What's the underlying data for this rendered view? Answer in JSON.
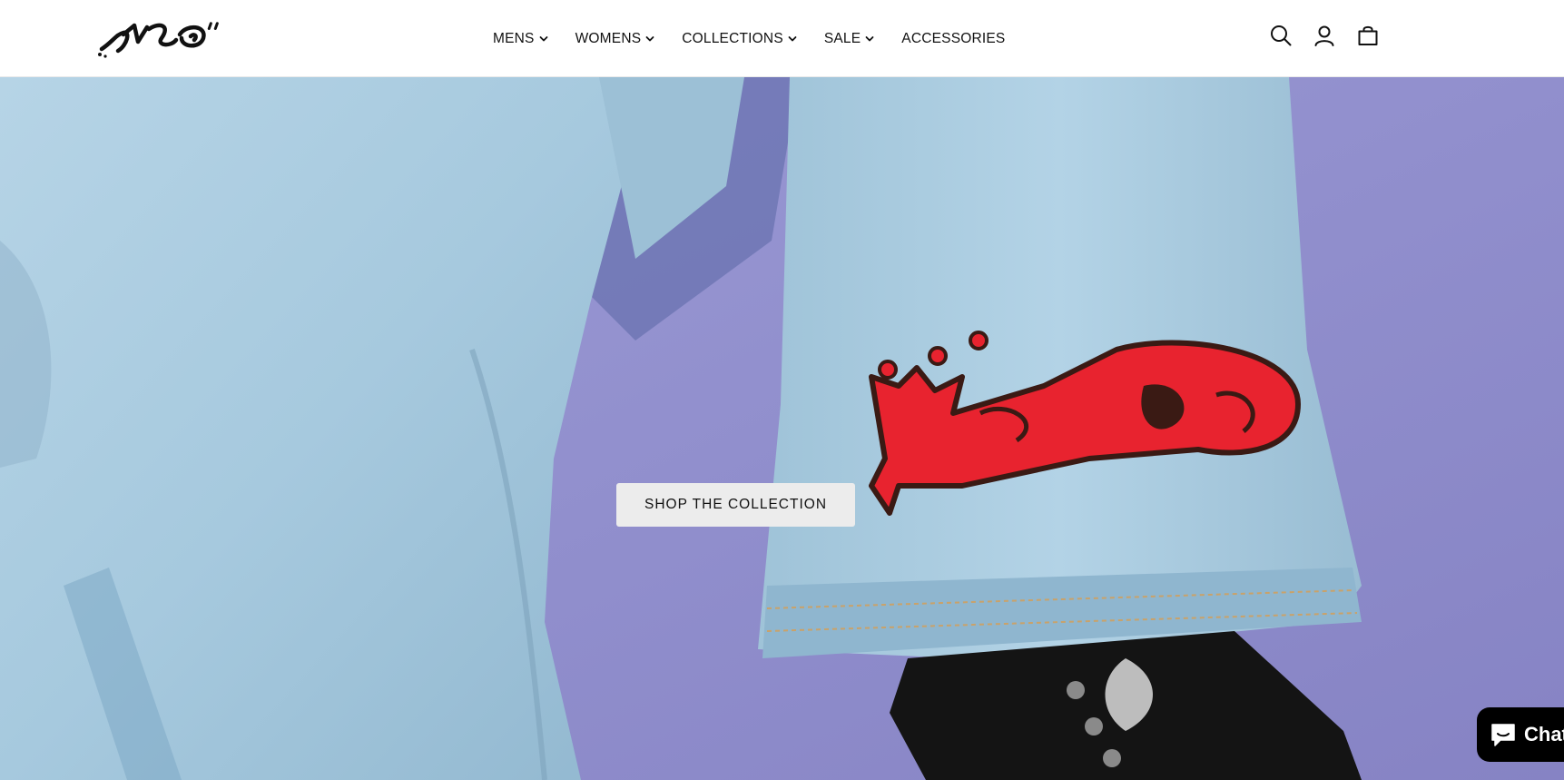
{
  "brand": {
    "logo_text": "JNCO",
    "icon": "jnco-graffiti-logo"
  },
  "nav": {
    "items": [
      {
        "label": "MENS",
        "has_dropdown": true,
        "icon": "chevron-down-icon"
      },
      {
        "label": "WOMENS",
        "has_dropdown": true,
        "icon": "chevron-down-icon"
      },
      {
        "label": "COLLECTIONS",
        "has_dropdown": true,
        "icon": "chevron-down-icon"
      },
      {
        "label": "SALE",
        "has_dropdown": true,
        "icon": "chevron-down-icon"
      },
      {
        "label": "ACCESSORIES",
        "has_dropdown": false
      }
    ]
  },
  "header_icons": [
    {
      "name": "search-icon"
    },
    {
      "name": "account-icon"
    },
    {
      "name": "cart-icon"
    }
  ],
  "hero": {
    "cta_label": "SHOP THE COLLECTION",
    "background_color": "#8f8dcc",
    "denim_color": "#a9cce0",
    "patch_color": "#e8232f",
    "patch_text": "JNCO"
  },
  "chat_widget": {
    "label": "Chat",
    "icon": "chat-bubble-icon",
    "color": "#000000"
  }
}
